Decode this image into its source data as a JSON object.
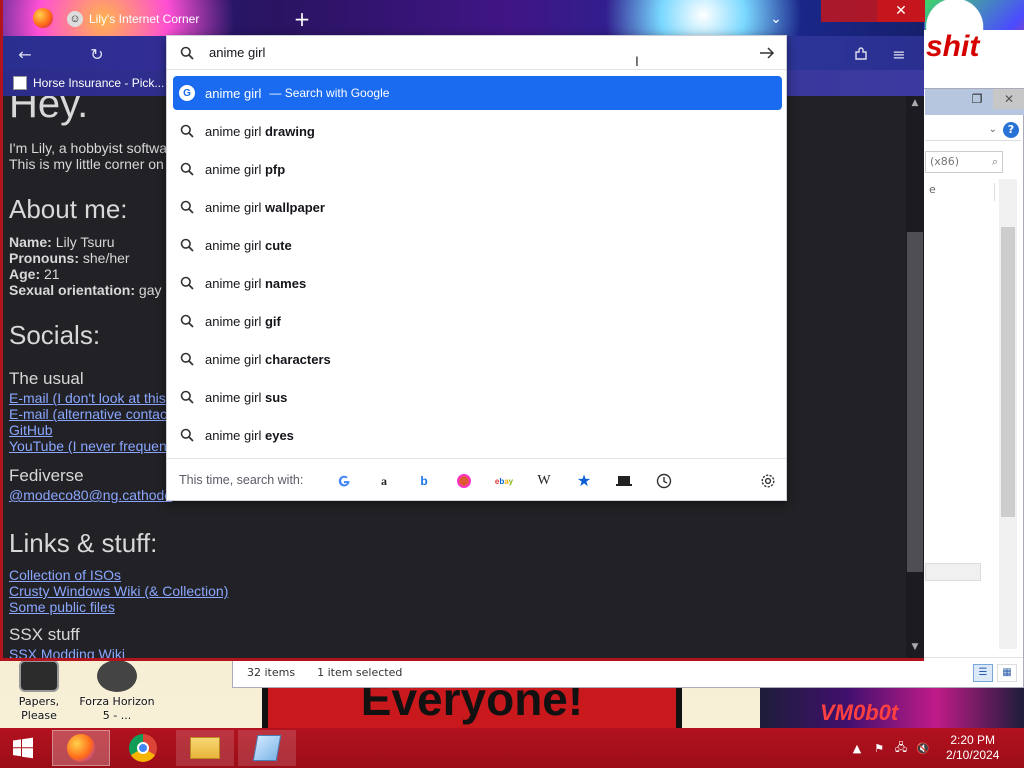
{
  "browser": {
    "tab_title": "Lily's Internet Corner",
    "bookmark_label": "Horse Insurance - Pick..."
  },
  "urlbar": {
    "query": "anime girl ",
    "google_suggestion": {
      "text": "anime girl",
      "action": "— Search with Google"
    },
    "suggestions": [
      {
        "prefix": "anime girl",
        "bold": "drawing"
      },
      {
        "prefix": "anime girl",
        "bold": "pfp"
      },
      {
        "prefix": "anime girl",
        "bold": "wallpaper"
      },
      {
        "prefix": "anime girl",
        "bold": "cute"
      },
      {
        "prefix": "anime girl",
        "bold": "names"
      },
      {
        "prefix": "anime girl",
        "bold": "gif"
      },
      {
        "prefix": "anime girl",
        "bold": "characters"
      },
      {
        "prefix": "anime girl",
        "bold": "sus"
      },
      {
        "prefix": "anime girl",
        "bold": "eyes"
      }
    ],
    "footer_label": "This time, search with:",
    "engines": [
      "google",
      "amazon",
      "bing",
      "duckduckgo",
      "ebay",
      "wikipedia",
      "bookmarks",
      "tabs",
      "history"
    ]
  },
  "page": {
    "heading": "Hey.",
    "intro1": "I'm Lily, a hobbyist softwa",
    "intro2": "This is my little corner on",
    "about_heading": "About me:",
    "name_label": "Name:",
    "name_value": "Lily Tsuru",
    "pronouns_label": "Pronouns:",
    "pronouns_value": "she/her",
    "age_label": "Age:",
    "age_value": "21",
    "orientation_label": "Sexual orientation:",
    "orientation_value": "gay",
    "socials_heading": "Socials:",
    "usual_heading": "The usual",
    "link_email": "E-mail (I don't look at this",
    "link_email_alt": "E-mail (alternative contac",
    "link_github": "GitHub",
    "link_youtube": "YouTube (I never frequen",
    "fediverse_heading": "Fediverse",
    "link_fediverse": "@modeco80@ng.cathode",
    "links_heading": "Links & stuff:",
    "link_isos": "Collection of ISOs",
    "link_wiki": "Crusty Windows Wiki (& Collection)",
    "link_files": "Some public files",
    "ssx_heading": "SSX stuff",
    "link_ssx": "SSX Modding Wiki"
  },
  "explorer": {
    "search_placeholder": "(x86)",
    "column_header": "e",
    "items_count": "32 items",
    "selection": "1 item selected"
  },
  "desktop": {
    "icon1_label": "Papers, Please",
    "icon2_label": "Forza Horizon 5 - ...",
    "banner_everyone": "Everyone!",
    "banner_corner": "shit",
    "banner_neon": "VM0b0t"
  },
  "taskbar": {
    "time": "2:20 PM",
    "date": "2/10/2024"
  }
}
